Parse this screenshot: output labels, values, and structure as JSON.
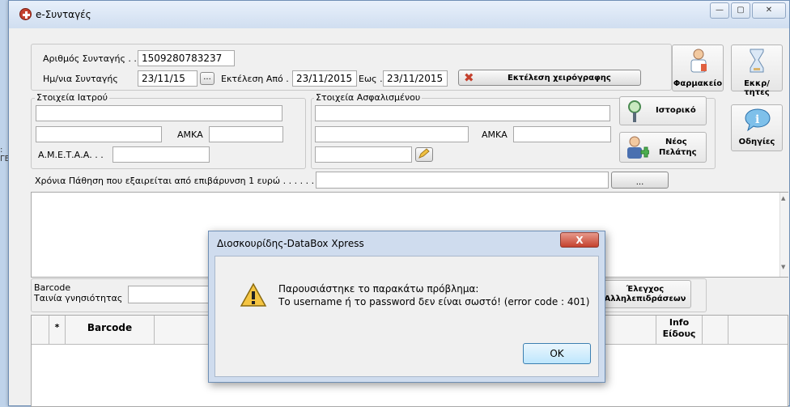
{
  "window": {
    "title": "e-Συνταγές",
    "btn_min": "—",
    "btn_max": "▢",
    "btn_close": "✕"
  },
  "form": {
    "prescription_number_label": "Αριθμός Συνταγής . .",
    "prescription_number_value": "1509280783237",
    "prescription_date_label": "Ημ/νια Συνταγής",
    "prescription_date_value": "23/11/15",
    "date_picker_label": "...",
    "execution_from_label": "Εκτέλεση Από .",
    "execution_from_value": "23/11/2015",
    "to_label": "Εως .",
    "to_value": "23/11/2015",
    "manual_execution_button": "Εκτέλεση χειρόγραφης"
  },
  "side_buttons": {
    "pharmacy": "Φαρμακείο",
    "pending": "Εκκρ/τητες",
    "history": "Ιστορικό",
    "new_client_line1": "Νέος",
    "new_client_line2": "Πελάτης",
    "instructions": "Οδηγίες"
  },
  "doctor": {
    "group_title": "Στοιχεία Ιατρού",
    "amka_label": "ΑΜΚΑ",
    "ametaa_label": "Α.Μ.Ε.Τ.Α.Α. . ."
  },
  "insured": {
    "group_title": "Στοιχεία Ασφαλισμένου",
    "amka_label": "ΑΜΚΑ"
  },
  "chronic": {
    "label": "Χρόνια Πάθηση που εξαιρείται από επιβάρυνση 1 ευρώ . . . . . . .",
    "browse_label": "..."
  },
  "barcode_section": {
    "barcode_label": "Barcode",
    "tape_label": "Ταινία γνησιότητας",
    "interactions_line1": "Έλεγχος",
    "interactions_line2": "Αλληλεπιδράσεων"
  },
  "table": {
    "col_star": "*",
    "col_barcode": "Barcode",
    "col_info_line1": "Info",
    "col_info_line2": "Είδους"
  },
  "dialog": {
    "title": "Διοσκουρίδης-DataBox Xpress",
    "close_label": "X",
    "message_line1": "Παρουσιάστηκε το παρακάτω πρόβλημα:",
    "message_line2": "Το username ή το password δεν είναι σωστό! (error code : 401)",
    "ok_label": "OK"
  },
  "colors": {
    "accent": "#c4412e",
    "title_bar": "#d0def0",
    "window_bg": "#f0f0f0"
  }
}
